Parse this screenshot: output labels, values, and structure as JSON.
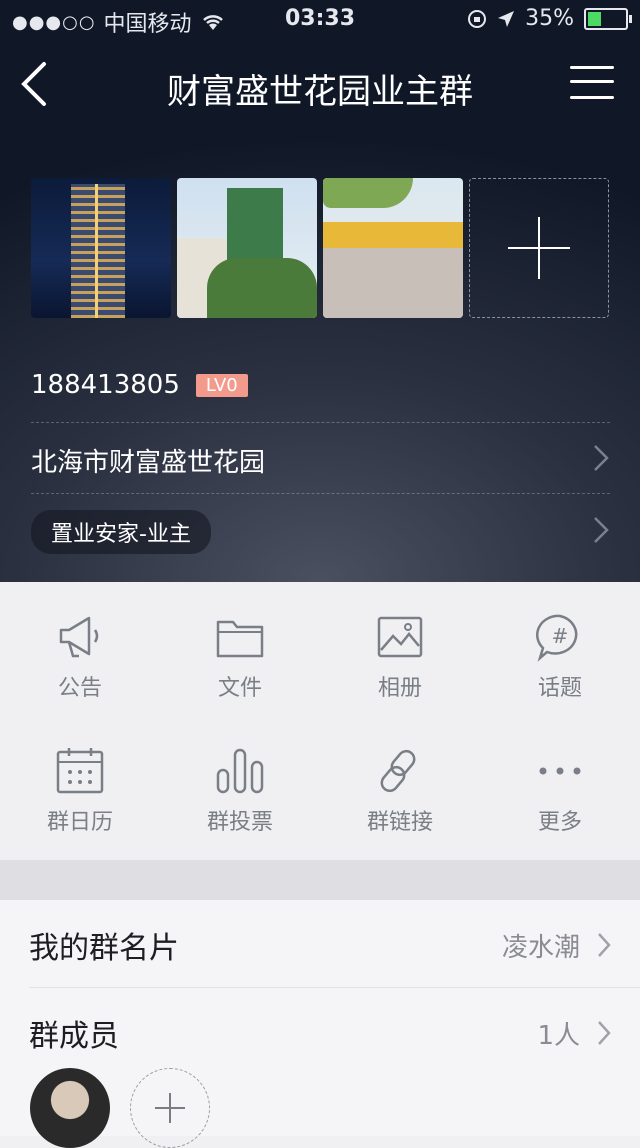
{
  "status": {
    "carrier": "中国移动",
    "time": "03:33",
    "battery": "35%",
    "battery_level": 0.35
  },
  "nav": {
    "title": "财富盛世花园业主群",
    "back_icon": "chevron-left-icon",
    "menu_icon": "hamburger-menu-icon"
  },
  "group": {
    "id": "188413805",
    "level": "LV0",
    "location": "北海市财富盛世花园",
    "category": "置业安家-业主"
  },
  "features": [
    {
      "label": "公告",
      "icon": "megaphone-icon"
    },
    {
      "label": "文件",
      "icon": "folder-icon"
    },
    {
      "label": "相册",
      "icon": "album-icon"
    },
    {
      "label": "话题",
      "icon": "topic-icon"
    },
    {
      "label": "群日历",
      "icon": "calendar-icon"
    },
    {
      "label": "群投票",
      "icon": "vote-icon"
    },
    {
      "label": "群链接",
      "icon": "link-icon"
    },
    {
      "label": "更多",
      "icon": "more-icon"
    }
  ],
  "list": {
    "card_label": "我的群名片",
    "card_value": "凌水潮",
    "members_label": "群成员",
    "members_count": "1人"
  },
  "colors": {
    "level_badge": "#f29a8c",
    "battery_fill": "#4cd964",
    "icon_gray": "#7a7e86"
  }
}
